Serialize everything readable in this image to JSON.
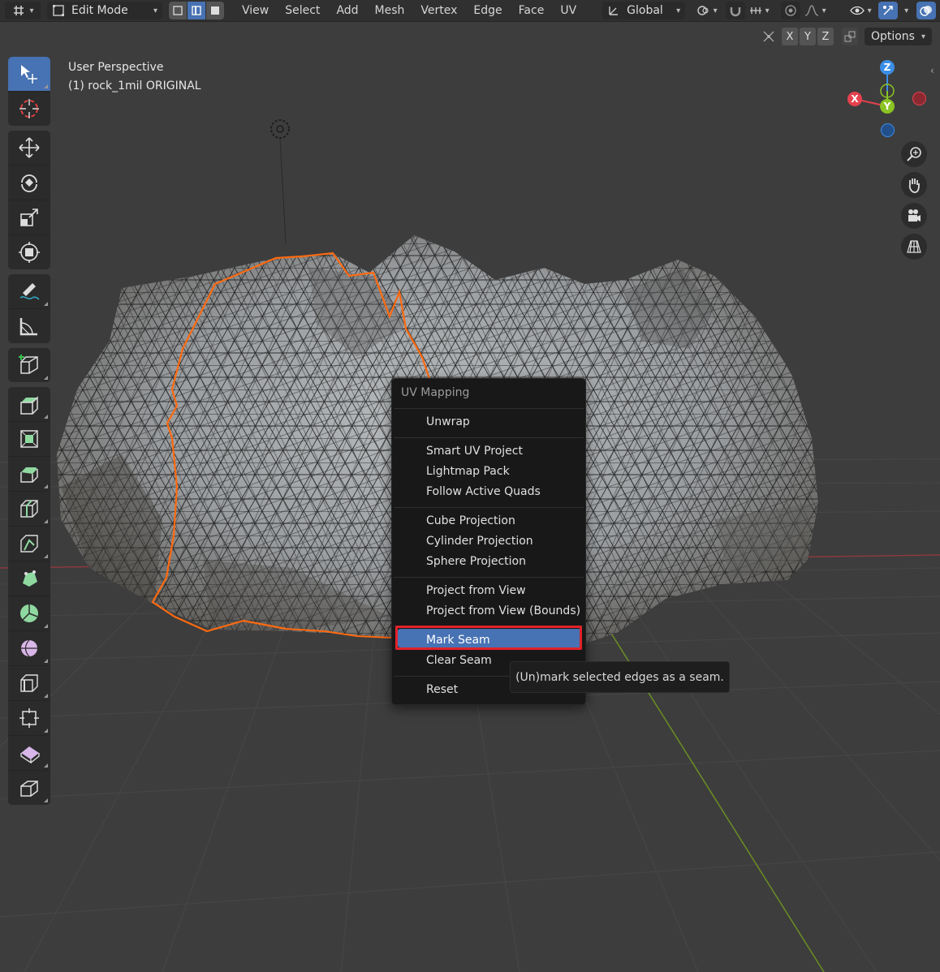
{
  "header": {
    "mode": "Edit Mode",
    "menus": [
      "View",
      "Select",
      "Add",
      "Mesh",
      "Vertex",
      "Edge",
      "Face",
      "UV"
    ],
    "transform_orientation": "Global",
    "axis_x": "X",
    "axis_y": "Y",
    "axis_z": "Z",
    "options": "Options"
  },
  "viewport": {
    "perspective": "User Perspective",
    "object": "(1) rock_1mil ORIGINAL"
  },
  "gizmo": {
    "x": "X",
    "y": "Y",
    "z": "Z"
  },
  "uv_menu": {
    "title": "UV Mapping",
    "items": [
      "Unwrap",
      "Smart UV Project",
      "Lightmap Pack",
      "Follow Active Quads",
      "Cube Projection",
      "Cylinder Projection",
      "Sphere Projection",
      "Project from View",
      "Project from View (Bounds)",
      "Mark Seam",
      "Clear Seam",
      "Reset"
    ],
    "highlighted": "Mark Seam"
  },
  "tooltip": "(Un)mark selected edges as a seam.",
  "colors": {
    "active_blue": "#4772b3",
    "seam_orange": "#ff6a10",
    "highlight_red": "#e22229",
    "axis_x": "#e5414e",
    "axis_y": "#8bc423",
    "axis_z": "#3a8ee6"
  }
}
